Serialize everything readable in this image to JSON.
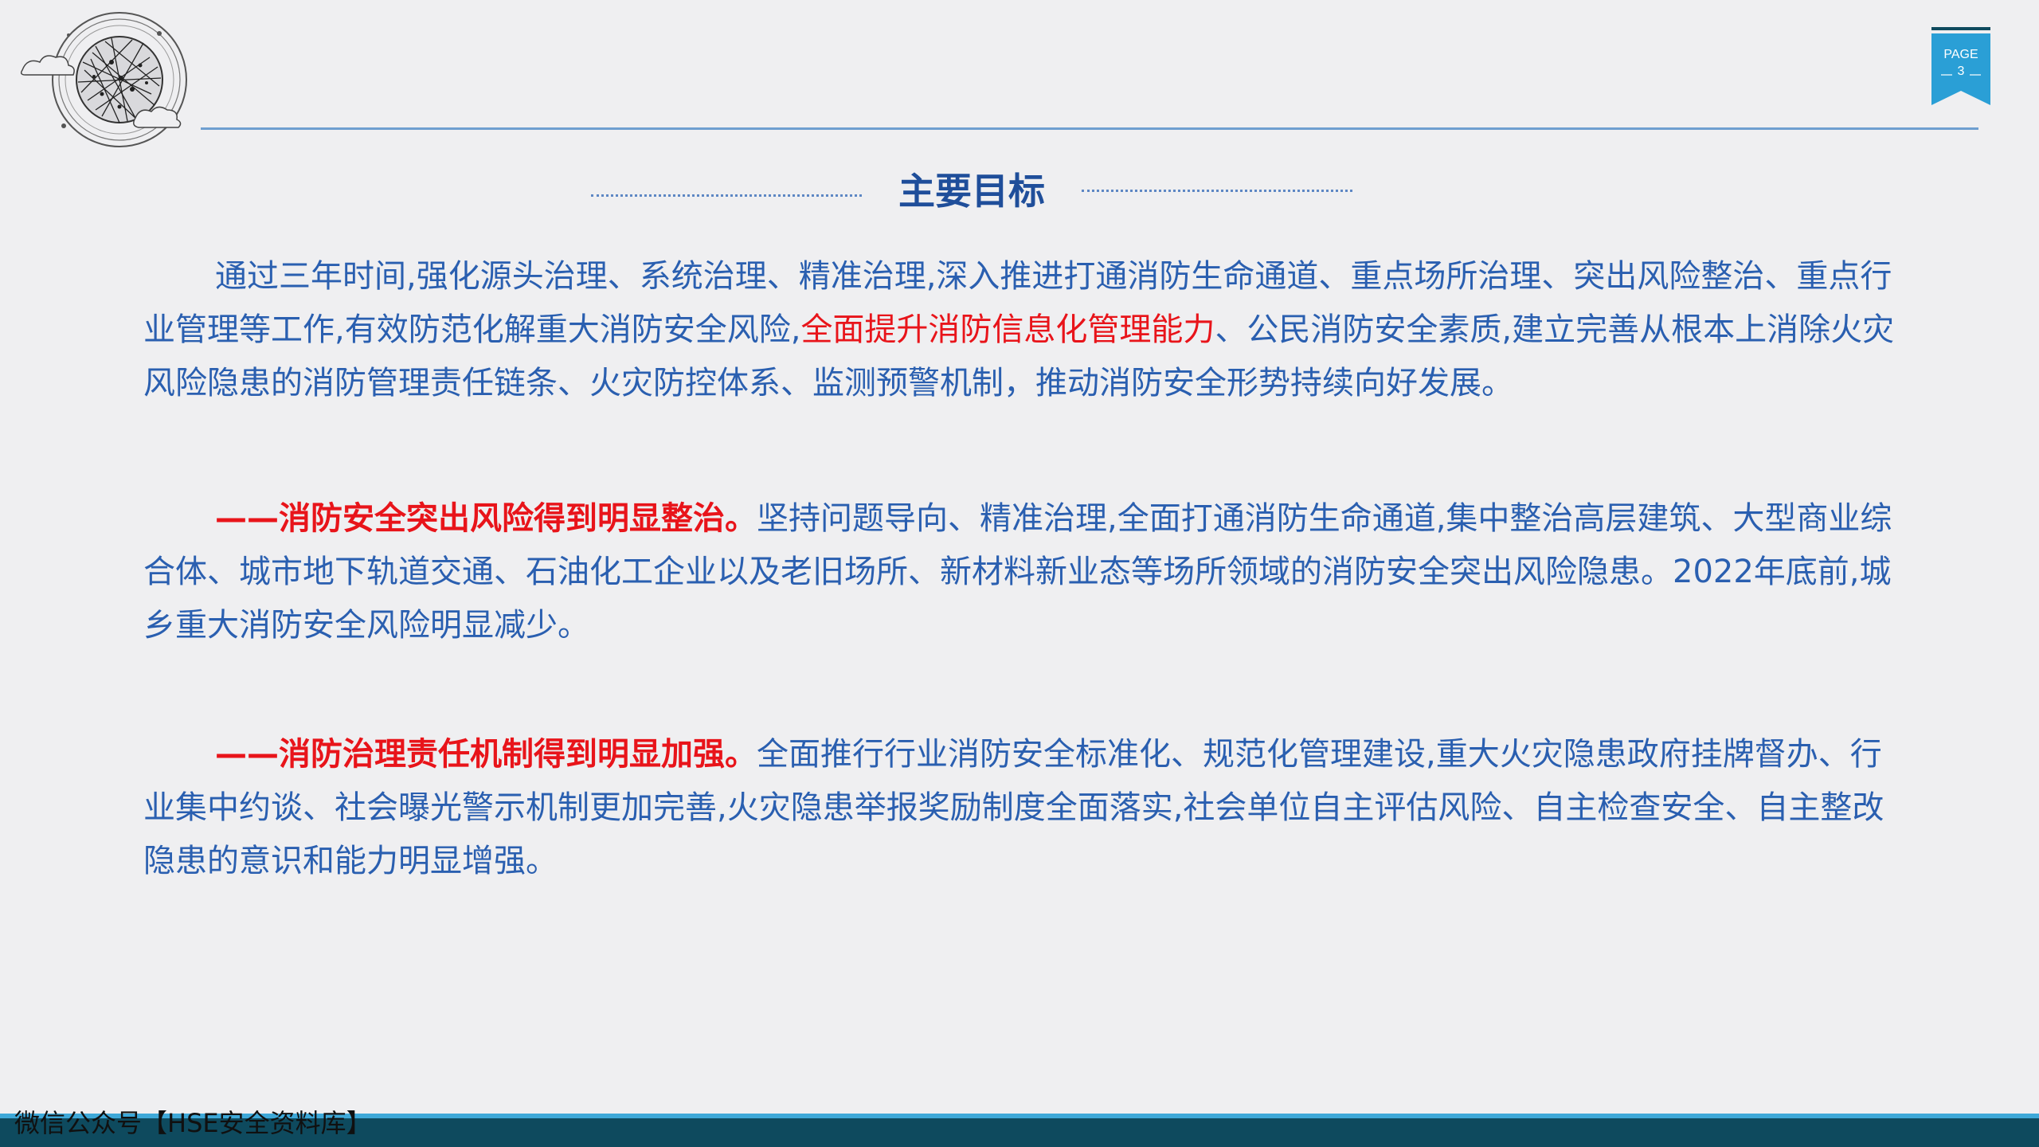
{
  "header": {
    "logo_icon": "globe-network-logo-icon",
    "page_label": "PAGE",
    "page_number": "3",
    "accent_color": "#2a9fd6"
  },
  "title": "主要目标",
  "paragraphs": [
    {
      "segments": [
        {
          "text": "通过三年时间,强化源头治理、系统治理、精准治理,深入推进打通消防生命通道、重点场所治理、突出风险整治、重点行业管理等工作,有效防范化解重大消防安全风险,",
          "style": "normal"
        },
        {
          "text": "全面提升消防信息化管理能力",
          "style": "red"
        },
        {
          "text": "、公民消防安全素质,建立完善从根本上消除火灾风险隐患的消防管理责任链条、火灾防控体系、监测预警机制，推动消防安全形势持续向好发展。",
          "style": "normal"
        }
      ]
    },
    {
      "segments": [
        {
          "text": "——消防安全突出风险得到明显整治。",
          "style": "red-bold"
        },
        {
          "text": "坚持问题导向、精准治理,全面打通消防生命通道,集中整治高层建筑、大型商业综合体、城市地下轨道交通、石油化工企业以及老旧场所、新材料新业态等场所领域的消防安全突出风险隐患。2022年底前,城乡重大消防安全风险明显减少。",
          "style": "normal"
        }
      ]
    },
    {
      "segments": [
        {
          "text": "——消防治理责任机制得到明显加强。",
          "style": "red-bold"
        },
        {
          "text": "全面推行行业消防安全标准化、规范化管理建设,重大火灾隐患政府挂牌督办、行业集中约谈、社会曝光警示机制更加完善,火灾隐患举报奖励制度全面落实,社会单位自主评估风险、自主检查安全、自主整改隐患的意识和能力明显增强。",
          "style": "normal"
        }
      ]
    }
  ],
  "footer": {
    "text": "微信公众号【HSE安全资料库】"
  },
  "colors": {
    "body_text": "#2a5fb0",
    "highlight": "#e8141a",
    "title": "#1f4e9a",
    "footer_bar": "#0e4a5e"
  }
}
